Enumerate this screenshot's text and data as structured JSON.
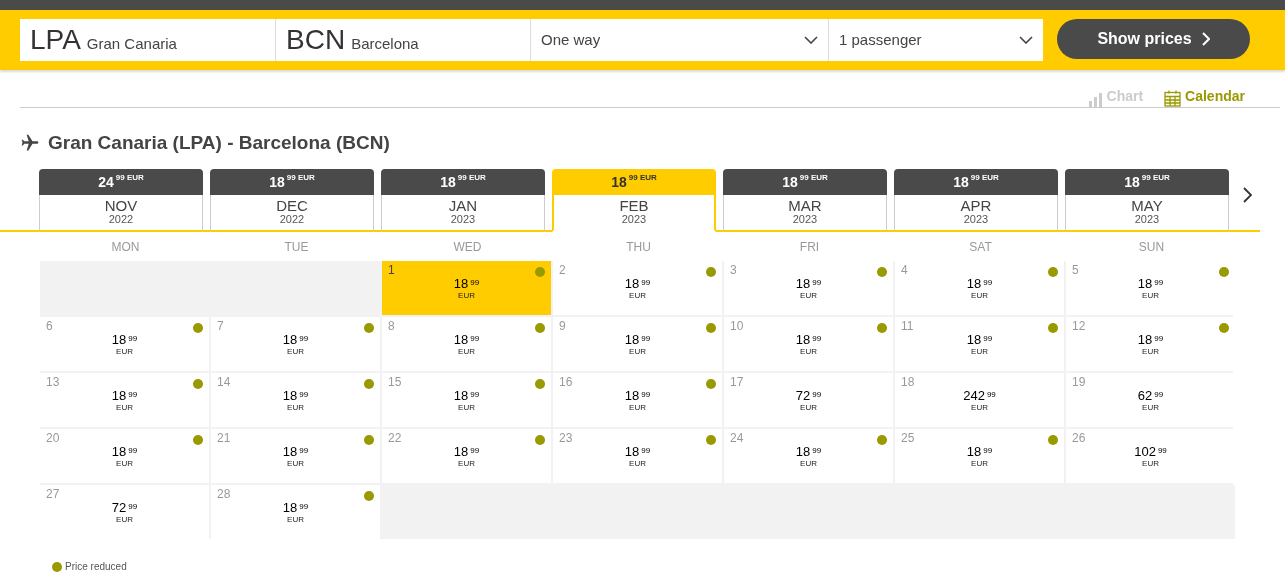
{
  "search": {
    "origin": {
      "code": "LPA",
      "city": "Gran Canaria"
    },
    "destination": {
      "code": "BCN",
      "city": "Barcelona"
    },
    "trip_type": "One way",
    "passengers": "1 passenger",
    "button": "Show prices"
  },
  "view_toggles": [
    {
      "label": "Chart",
      "selected": false
    },
    {
      "label": "Calendar",
      "selected": true
    }
  ],
  "route_title": "Gran Canaria (LPA) - Barcelona (BCN)",
  "months": [
    {
      "price": "24",
      "cents": "99",
      "currency": "EUR",
      "month": "NOV",
      "year": "2022",
      "selected": false
    },
    {
      "price": "18",
      "cents": "99",
      "currency": "EUR",
      "month": "DEC",
      "year": "2022",
      "selected": false
    },
    {
      "price": "18",
      "cents": "99",
      "currency": "EUR",
      "month": "JAN",
      "year": "2023",
      "selected": false
    },
    {
      "price": "18",
      "cents": "99",
      "currency": "EUR",
      "month": "FEB",
      "year": "2023",
      "selected": true
    },
    {
      "price": "18",
      "cents": "99",
      "currency": "EUR",
      "month": "MAR",
      "year": "2023",
      "selected": false
    },
    {
      "price": "18",
      "cents": "99",
      "currency": "EUR",
      "month": "APR",
      "year": "2023",
      "selected": false
    },
    {
      "price": "18",
      "cents": "99",
      "currency": "EUR",
      "month": "MAY",
      "year": "2023",
      "selected": false
    }
  ],
  "weekdays": [
    "MON",
    "TUE",
    "WED",
    "THU",
    "FRI",
    "SAT",
    "SUN"
  ],
  "days": [
    {
      "kind": "empty"
    },
    {
      "kind": "empty"
    },
    {
      "kind": "day",
      "day": "1",
      "price": "18",
      "cents": "99",
      "currency": "EUR",
      "reduced": true,
      "selected": true
    },
    {
      "kind": "day",
      "day": "2",
      "price": "18",
      "cents": "99",
      "currency": "EUR",
      "reduced": true,
      "selected": false
    },
    {
      "kind": "day",
      "day": "3",
      "price": "18",
      "cents": "99",
      "currency": "EUR",
      "reduced": true,
      "selected": false
    },
    {
      "kind": "day",
      "day": "4",
      "price": "18",
      "cents": "99",
      "currency": "EUR",
      "reduced": true,
      "selected": false
    },
    {
      "kind": "day",
      "day": "5",
      "price": "18",
      "cents": "99",
      "currency": "EUR",
      "reduced": true,
      "selected": false
    },
    {
      "kind": "day",
      "day": "6",
      "price": "18",
      "cents": "99",
      "currency": "EUR",
      "reduced": true,
      "selected": false
    },
    {
      "kind": "day",
      "day": "7",
      "price": "18",
      "cents": "99",
      "currency": "EUR",
      "reduced": true,
      "selected": false
    },
    {
      "kind": "day",
      "day": "8",
      "price": "18",
      "cents": "99",
      "currency": "EUR",
      "reduced": true,
      "selected": false
    },
    {
      "kind": "day",
      "day": "9",
      "price": "18",
      "cents": "99",
      "currency": "EUR",
      "reduced": true,
      "selected": false
    },
    {
      "kind": "day",
      "day": "10",
      "price": "18",
      "cents": "99",
      "currency": "EUR",
      "reduced": true,
      "selected": false
    },
    {
      "kind": "day",
      "day": "11",
      "price": "18",
      "cents": "99",
      "currency": "EUR",
      "reduced": true,
      "selected": false
    },
    {
      "kind": "day",
      "day": "12",
      "price": "18",
      "cents": "99",
      "currency": "EUR",
      "reduced": true,
      "selected": false
    },
    {
      "kind": "day",
      "day": "13",
      "price": "18",
      "cents": "99",
      "currency": "EUR",
      "reduced": true,
      "selected": false
    },
    {
      "kind": "day",
      "day": "14",
      "price": "18",
      "cents": "99",
      "currency": "EUR",
      "reduced": true,
      "selected": false
    },
    {
      "kind": "day",
      "day": "15",
      "price": "18",
      "cents": "99",
      "currency": "EUR",
      "reduced": true,
      "selected": false
    },
    {
      "kind": "day",
      "day": "16",
      "price": "18",
      "cents": "99",
      "currency": "EUR",
      "reduced": true,
      "selected": false
    },
    {
      "kind": "day",
      "day": "17",
      "price": "72",
      "cents": "99",
      "currency": "EUR",
      "reduced": false,
      "selected": false
    },
    {
      "kind": "day",
      "day": "18",
      "price": "242",
      "cents": "99",
      "currency": "EUR",
      "reduced": false,
      "selected": false
    },
    {
      "kind": "day",
      "day": "19",
      "price": "62",
      "cents": "99",
      "currency": "EUR",
      "reduced": false,
      "selected": false
    },
    {
      "kind": "day",
      "day": "20",
      "price": "18",
      "cents": "99",
      "currency": "EUR",
      "reduced": true,
      "selected": false
    },
    {
      "kind": "day",
      "day": "21",
      "price": "18",
      "cents": "99",
      "currency": "EUR",
      "reduced": true,
      "selected": false
    },
    {
      "kind": "day",
      "day": "22",
      "price": "18",
      "cents": "99",
      "currency": "EUR",
      "reduced": true,
      "selected": false
    },
    {
      "kind": "day",
      "day": "23",
      "price": "18",
      "cents": "99",
      "currency": "EUR",
      "reduced": true,
      "selected": false
    },
    {
      "kind": "day",
      "day": "24",
      "price": "18",
      "cents": "99",
      "currency": "EUR",
      "reduced": true,
      "selected": false
    },
    {
      "kind": "day",
      "day": "25",
      "price": "18",
      "cents": "99",
      "currency": "EUR",
      "reduced": true,
      "selected": false
    },
    {
      "kind": "day",
      "day": "26",
      "price": "102",
      "cents": "99",
      "currency": "EUR",
      "reduced": false,
      "selected": false
    },
    {
      "kind": "day",
      "day": "27",
      "price": "72",
      "cents": "99",
      "currency": "EUR",
      "reduced": false,
      "selected": false
    },
    {
      "kind": "day",
      "day": "28",
      "price": "18",
      "cents": "99",
      "currency": "EUR",
      "reduced": true,
      "selected": false
    }
  ],
  "legend": "Price reduced"
}
